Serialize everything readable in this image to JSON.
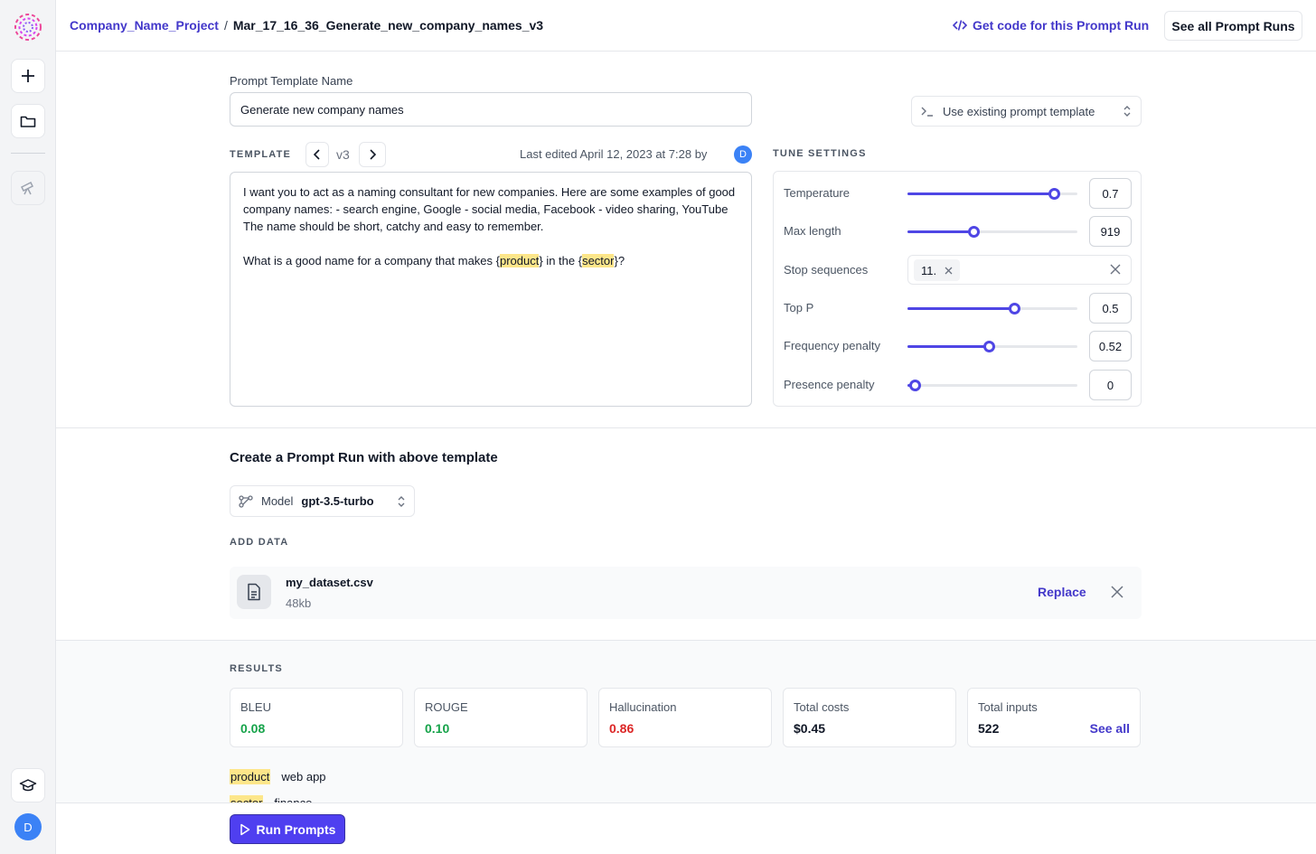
{
  "header": {
    "project": "Company_Name_Project",
    "separator": "/",
    "run_name": "Mar_17_16_36_Generate_new_company_names_v3",
    "get_code_label": "Get code for this Prompt Run",
    "see_all_runs_label": "See all Prompt Runs"
  },
  "sidebar": {
    "user_initial": "D"
  },
  "template_name": {
    "label": "Prompt Template Name",
    "value": "Generate new company names"
  },
  "use_existing": {
    "label": "Use existing prompt template"
  },
  "template": {
    "heading": "TEMPLATE",
    "version": "v3",
    "last_edited": "Last edited April 12, 2023 at 7:28 by",
    "editor_initial": "D",
    "line1": "I want you to act as a naming consultant for new companies. Here are some examples of good company names: - search engine, Google - social media, Facebook - video sharing, YouTube The name should be short, catchy and easy to remember.",
    "line2_pre": "What is a good name for a company that makes {",
    "var1": "product",
    "line2_mid": "} in the {",
    "var2": "sector",
    "line2_post": "}?"
  },
  "tune": {
    "heading": "TUNE SETTINGS",
    "temperature": {
      "label": "Temperature",
      "value": "0.7",
      "fraction": 0.86
    },
    "max_length": {
      "label": "Max length",
      "value": "919",
      "fraction": 0.39
    },
    "stop_sequences": {
      "label": "Stop sequences",
      "chip": "11."
    },
    "top_p": {
      "label": "Top P",
      "value": "0.5",
      "fraction": 0.63
    },
    "frequency_penalty": {
      "label": "Frequency penalty",
      "value": "0.52",
      "fraction": 0.48
    },
    "presence_penalty": {
      "label": "Presence penalty",
      "value": "0",
      "fraction": 0.04
    }
  },
  "create": {
    "title": "Create a Prompt Run with above template",
    "model_label": "Model",
    "model_value": "gpt-3.5-turbo",
    "add_data": "ADD DATA",
    "file_name": "my_dataset.csv",
    "file_size": "48kb",
    "replace_label": "Replace"
  },
  "results": {
    "heading": "RESULTS",
    "cards": [
      {
        "label": "BLEU",
        "value": "0.08"
      },
      {
        "label": "ROUGE",
        "value": "0.10"
      },
      {
        "label": "Hallucination",
        "value": "0.86"
      },
      {
        "label": "Total costs",
        "value": "$0.45"
      },
      {
        "label": "Total inputs",
        "value": "522"
      }
    ],
    "see_all_label": "See all",
    "vars": [
      {
        "key": "product",
        "value": "web app"
      },
      {
        "key": "sector",
        "value": "finance"
      }
    ]
  },
  "footer": {
    "run_label": "Run Prompts"
  },
  "colors": {
    "accent": "#4f46e5",
    "link": "#4338ca",
    "highlight": "#fde68a",
    "good": "#16a34a",
    "bad": "#dc2626"
  }
}
